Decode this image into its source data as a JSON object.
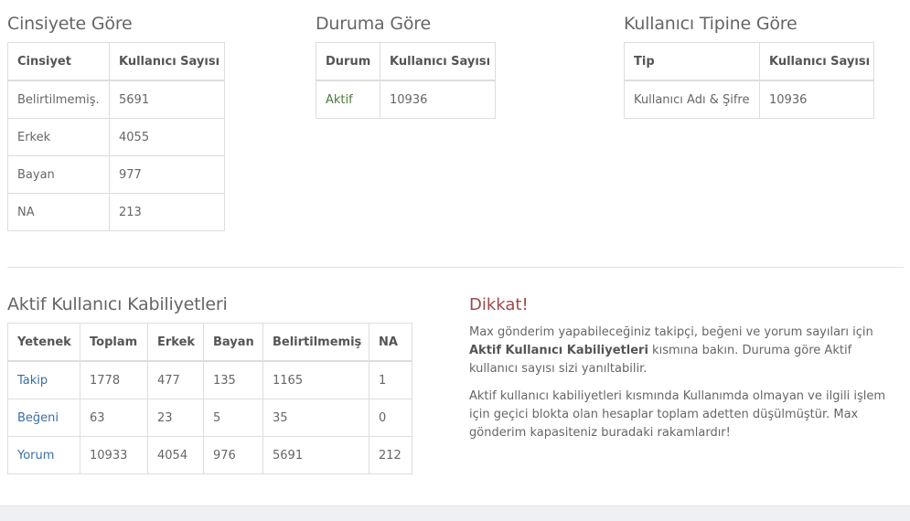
{
  "gender": {
    "title": "Cinsiyete Göre",
    "headers": [
      "Cinsiyet",
      "Kullanıcı Sayısı"
    ],
    "rows": [
      [
        "Belirtilmemiş.",
        "5691"
      ],
      [
        "Erkek",
        "4055"
      ],
      [
        "Bayan",
        "977"
      ],
      [
        "NA",
        "213"
      ]
    ]
  },
  "status": {
    "title": "Duruma Göre",
    "headers": [
      "Durum",
      "Kullanıcı Sayısı"
    ],
    "rows": [
      [
        "Aktif",
        "10936"
      ]
    ]
  },
  "usertype": {
    "title": "Kullanıcı Tipine Göre",
    "headers": [
      "Tip",
      "Kullanıcı Sayısı"
    ],
    "rows": [
      [
        "Kullanıcı Adı & Şifre",
        "10936"
      ]
    ]
  },
  "abilities": {
    "title": "Aktif Kullanıcı Kabiliyetleri",
    "headers": [
      "Yetenek",
      "Toplam",
      "Erkek",
      "Bayan",
      "Belirtilmemiş",
      "NA"
    ],
    "rows": [
      [
        "Takip",
        "1778",
        "477",
        "135",
        "1165",
        "1"
      ],
      [
        "Beğeni",
        "63",
        "23",
        "5",
        "35",
        "0"
      ],
      [
        "Yorum",
        "10933",
        "4054",
        "976",
        "5691",
        "212"
      ]
    ]
  },
  "notice": {
    "title": "Dikkat!",
    "p1_before": "Max gönderim yapabileceğiniz takipçi, beğeni ve yorum sayıları için ",
    "p1_bold": "Aktif Kullanıcı Kabiliyetleri",
    "p1_after": " kısmına bakın. Duruma göre Aktif kullanıcı sayısı sizi yanıltabilir.",
    "p2": "Aktif kullanıcı kabiliyetleri kısmında Kullanımda olmayan ve ilgili işlem için geçici blokta olan hesaplar toplam adetten düşülmüştür. Max gönderim kapasiteniz buradaki rakamlardır!"
  }
}
